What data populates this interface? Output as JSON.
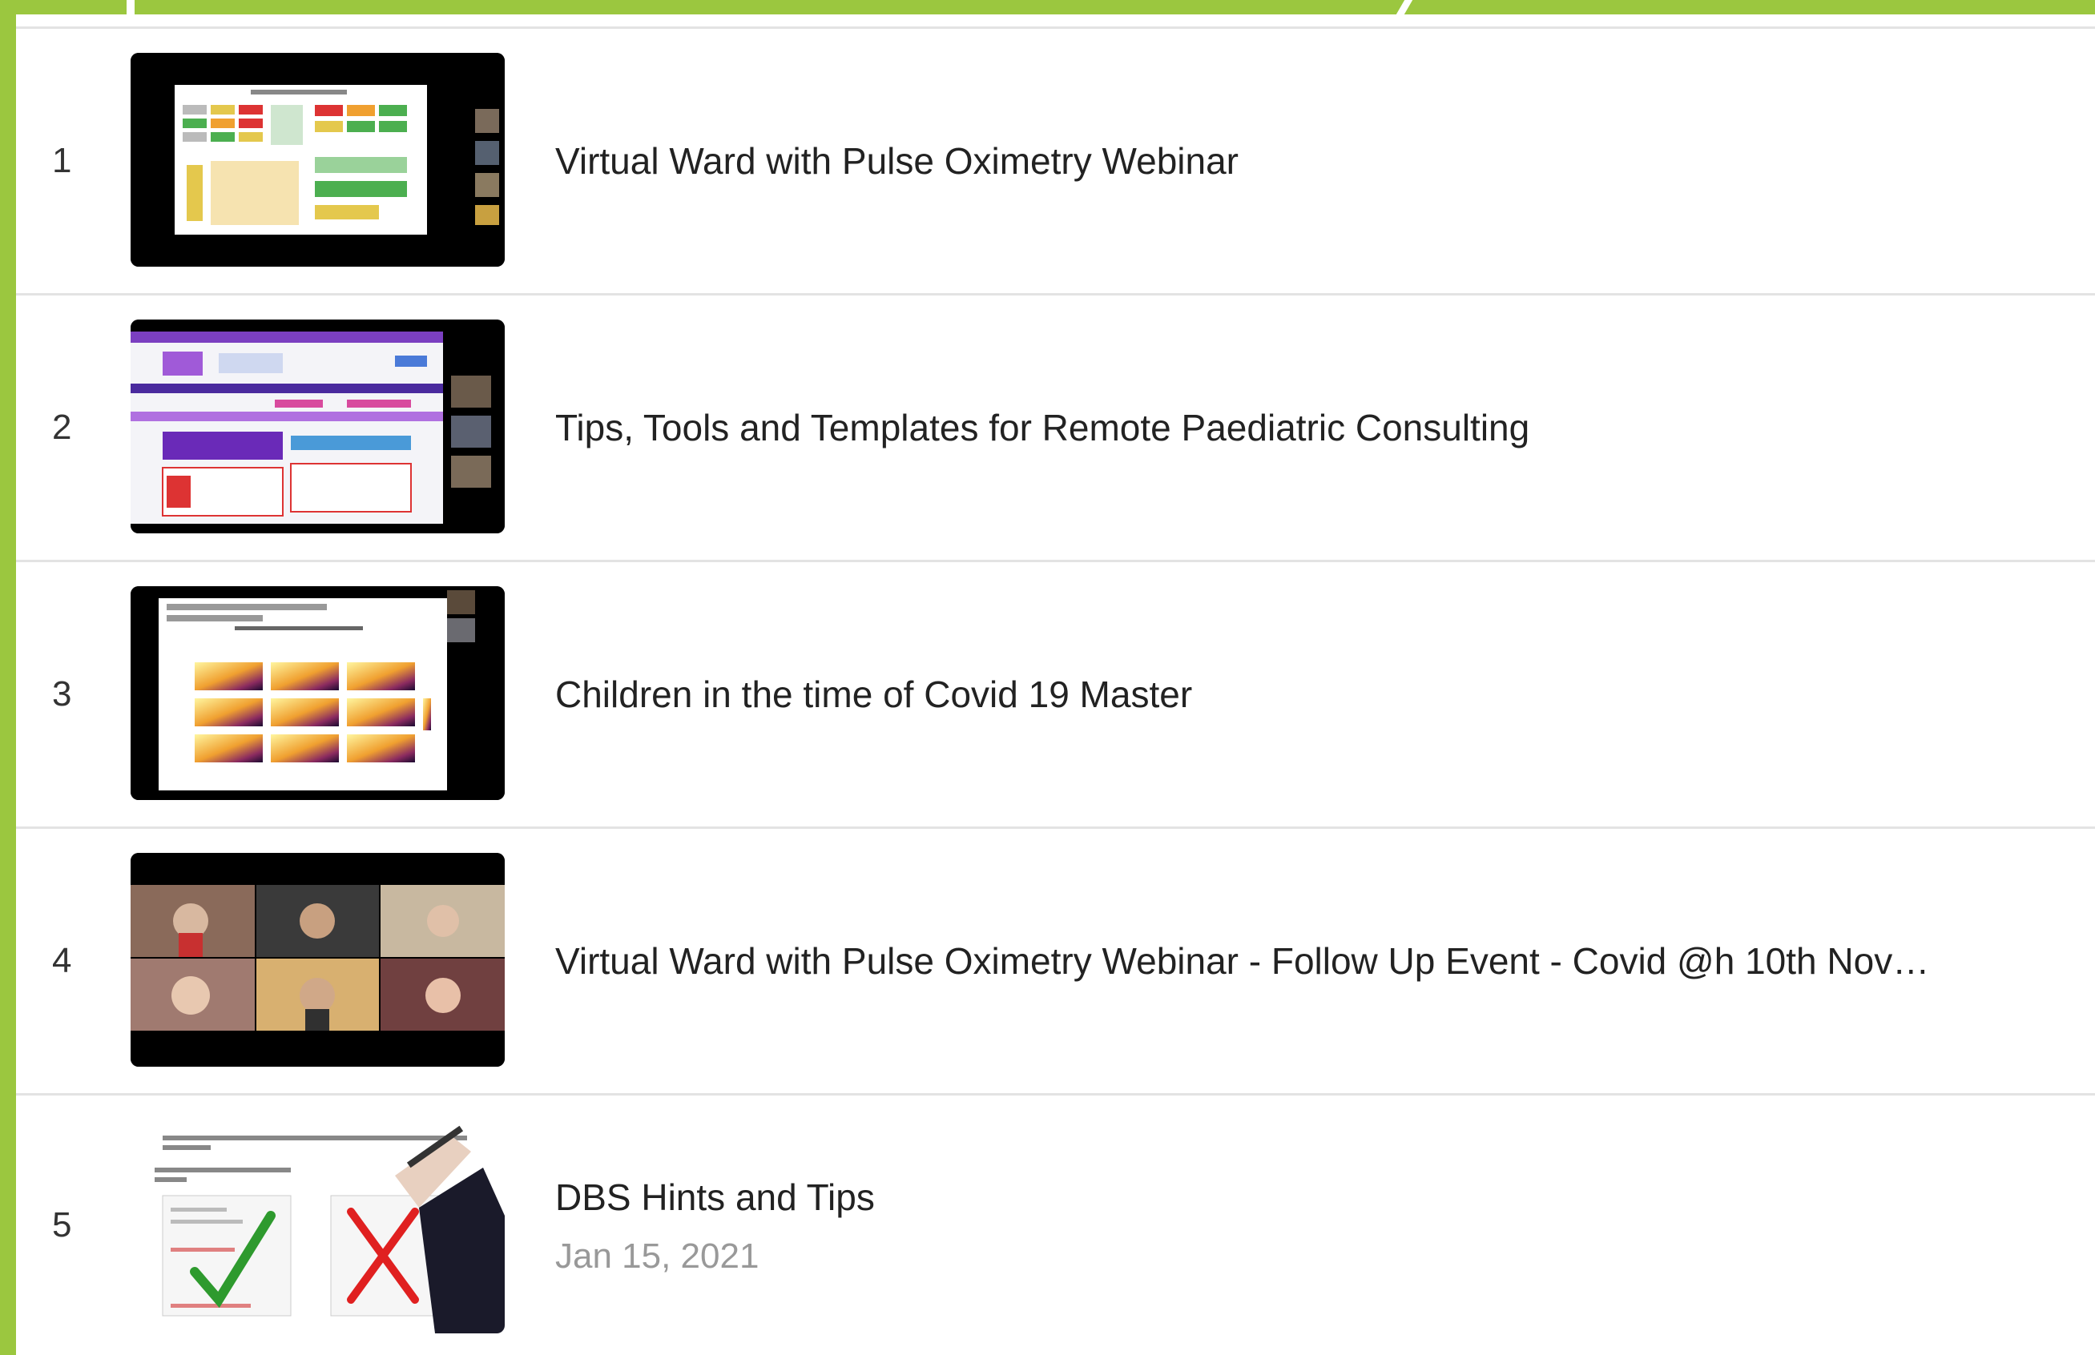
{
  "playlist": {
    "items": [
      {
        "index": "1",
        "title": "Virtual Ward with Pulse Oximetry Webinar",
        "thumbnail": "slide-with-colored-boxes"
      },
      {
        "index": "2",
        "title": "Tips, Tools and Templates for Remote Paediatric Consulting",
        "thumbnail": "website-screenshot"
      },
      {
        "index": "3",
        "title": "Children in the time of Covid 19 Master",
        "thumbnail": "heatmap-slide"
      },
      {
        "index": "4",
        "title": "Virtual Ward with Pulse Oximetry Webinar - Follow Up Event - Covid @h 10th Nov…",
        "thumbnail": "video-call-grid"
      },
      {
        "index": "5",
        "title": "DBS Hints and Tips",
        "date": "Jan 15, 2021",
        "thumbnail": "hand-drawn-checkmark-and-cross"
      }
    ]
  },
  "colors": {
    "accent": "#9bc73f",
    "separator": "#e3e3e3",
    "text": "#222222",
    "muted": "#999999"
  }
}
